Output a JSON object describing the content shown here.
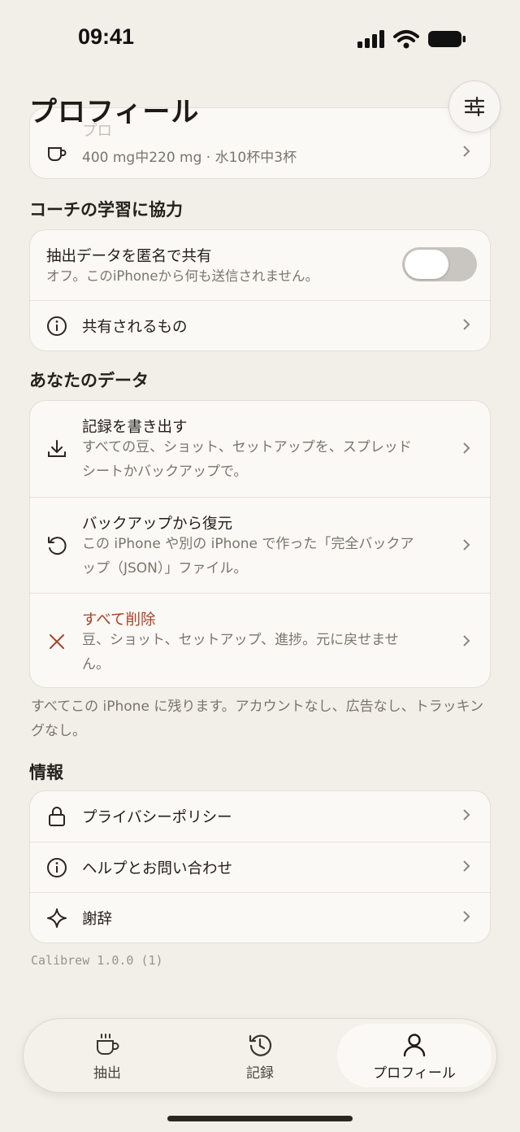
{
  "status": {
    "time": "09:41"
  },
  "header": {
    "title": "プロフィール"
  },
  "top_card": {
    "title": "プロ",
    "subtitle": "400 mg中220 mg · 水10杯中3杯"
  },
  "coach": {
    "section_title": "コーチの学習に協力",
    "share": {
      "title": "抽出データを匿名で共有",
      "subtitle": "オフ。このiPhoneから何も送信されません。",
      "toggle_on": false
    },
    "what_shared": {
      "title": "共有されるもの"
    }
  },
  "data_section": {
    "section_title": "あなたのデータ",
    "export": {
      "title": "記録を書き出す",
      "subtitle": "すべての豆、ショット、セットアップを、スプレッドシートかバックアップで。"
    },
    "restore": {
      "title": "バックアップから復元",
      "subtitle": "この iPhone や別の iPhone で作った「完全バックアップ（JSON）」ファイル。"
    },
    "delete": {
      "title": "すべて削除",
      "subtitle": "豆、ショット、セットアップ、進捗。元に戻せません。"
    },
    "footnote": "すべてこの iPhone に残ります。アカウントなし、広告なし、トラッキングなし。"
  },
  "info": {
    "section_title": "情報",
    "privacy": {
      "title": "プライバシーポリシー"
    },
    "help": {
      "title": "ヘルプとお問い合わせ"
    },
    "credits": {
      "title": "謝辞"
    }
  },
  "version": "Calibrew 1.0.0 (1)",
  "tabs": [
    {
      "label": "抽出",
      "icon": "cup-icon",
      "active": false
    },
    {
      "label": "記録",
      "icon": "history-icon",
      "active": false
    },
    {
      "label": "プロフィール",
      "icon": "person-icon",
      "active": true
    }
  ],
  "colors": {
    "background": "#f2eee8",
    "card": "#fbf9f5",
    "destructive": "#a8442a",
    "toggle_off": "#c9c5c0"
  }
}
